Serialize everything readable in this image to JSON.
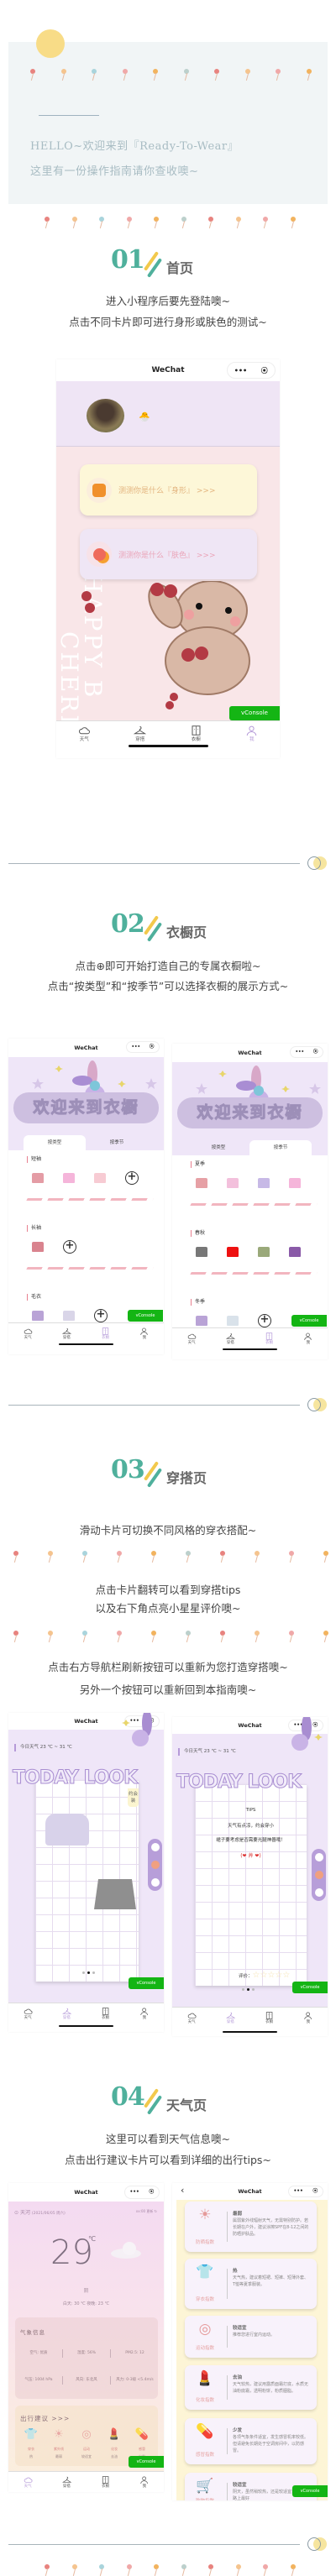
{
  "intro": {
    "greeting": "HELLO~欢迎来到『Ready-To-Wear』",
    "subtitle": "这里有一份操作指南请你查收噢~"
  },
  "colors": {
    "accent_teal": "#4fb09c",
    "accent_yellow": "#f2c94c",
    "lavender": "#efe5f5",
    "vconsole_green": "#14b514",
    "tab_active": "#b59ad8"
  },
  "lollipop_colors": [
    "#e8837f",
    "#f5c48e",
    "#a9d4dc",
    "#f0a8a8",
    "#f2b35e",
    "#bcd0cc",
    "#e8837f",
    "#f5c48e",
    "#f0a8a8",
    "#f2b35e"
  ],
  "sections": [
    {
      "num": "01",
      "title": "首页",
      "lines": [
        "进入小程序后要先登陆噢~",
        "点击不同卡片即可进行身形或肤色的测试~"
      ]
    },
    {
      "num": "02",
      "title": "衣橱页",
      "lines": [
        "点击⊕即可开始打造自己的专属衣橱啦~",
        "点击“按类型”和“按季节”可以选择衣橱的展示方式~"
      ]
    },
    {
      "num": "03",
      "title": "穿搭页",
      "lines": [
        "滑动卡片可切换不同风格的穿衣搭配~",
        "点击卡片翻转可以看到穿搭tips",
        "以及右下角点亮小星星评价噢~",
        "点击右方导航栏刷新按钮可以重新为您打造穿搭噢~",
        "另外一个按钮可以重新回到本指南噢~"
      ]
    },
    {
      "num": "04",
      "title": "天气页",
      "lines": [
        "这里可以看到天气信息噢~",
        "点击出行建议卡片可以看到详细的出行tips~"
      ]
    }
  ],
  "app": {
    "nav_title": "WeChat",
    "capsule_more": "•••",
    "capsule_close": "⦿",
    "back": "‹",
    "vconsole": "vConsole",
    "tabs": [
      {
        "label": "天气",
        "icon": "cloud-icon"
      },
      {
        "label": "穿搭",
        "icon": "hanger-icon"
      },
      {
        "label": "衣橱",
        "icon": "wardrobe-icon"
      },
      {
        "label": "我",
        "icon": "user-icon"
      }
    ]
  },
  "home": {
    "body_test": "测测你是什么『身形』 >>>",
    "skin_test": "测测你是什么『肤色』 >>>",
    "bg_text_1": "HAPPY B",
    "bg_text_2": "CHERR"
  },
  "wardrobe": {
    "banner": "欢迎来到衣橱",
    "tabs": [
      "按类型",
      "按季节"
    ],
    "by_type": [
      "短袖",
      "长袖",
      "毛衣"
    ],
    "by_season": [
      "夏季",
      "春秋",
      "冬季"
    ],
    "add": "+"
  },
  "outfit": {
    "weather": "今日天气 23 ℃ ~ 31 ℃",
    "banner": "TODAY LOOK",
    "tag": "约会装",
    "tips_title": "TIPS",
    "tips_1": "天气有点凉，约会穿小",
    "tips_2": "裙子要考虑是否需要光腿神器哦！",
    "kaomoji": "(❤ 艸 ❤)",
    "rating_label": "评价：",
    "rating": 0,
    "rating_max": 5,
    "current_slide": 2,
    "slides": 3
  },
  "weather": {
    "location": "天河",
    "date": "(2021/06/05 周六)",
    "update": "xx:00 更新",
    "temp": "29",
    "unit": "℃",
    "condition": "阴",
    "day_night": "白天: 30 ℃  夜晚: 23 ℃",
    "info_title": "气象信息",
    "info": [
      [
        "空气: 优质",
        "湿度: 56%",
        "PM2.5: 12"
      ],
      [
        "气压: 1004 hPa",
        "风向: 东北风",
        "风力: 0-3级 <5.4m/s"
      ]
    ],
    "advice_title": "出行建议 >>>",
    "advice_icons": [
      {
        "label": "穿衣",
        "value": "热"
      },
      {
        "label": "紫外线",
        "value": "最弱"
      },
      {
        "label": "运动",
        "value": "较适宜"
      },
      {
        "label": "化妆",
        "value": "去油"
      },
      {
        "label": "感冒",
        "value": "少发"
      }
    ]
  },
  "advice": [
    {
      "label": "防晒指数",
      "title": "最弱",
      "desc": "属弱紫外线辐射天气，无需特别防护。若长期在户外，建议涂擦SPF在8-12之间的防晒护肤品。",
      "icon": "sun-icon"
    },
    {
      "label": "穿衣指数",
      "title": "热",
      "desc": "天气热，建议着短裙、短裤、短薄外套、T恤等夏季服装。",
      "icon": "shirt-icon"
    },
    {
      "label": "运动指数",
      "title": "较适宜",
      "desc": "推荐您进行室内运动。",
      "icon": "ball-icon"
    },
    {
      "label": "化妆指数",
      "title": "去油",
      "desc": "天气较热，建议用露质面霜打底，水质无油粉底霜，透明粉饼，粉质胭脂。",
      "icon": "makeup-icon"
    },
    {
      "label": "感冒指数",
      "title": "少发",
      "desc": "各项气象条件适宜，发生感冒机率较低。但请避免长期处于空调房间中，以防感冒。",
      "icon": "pill-icon"
    },
    {
      "label": "购物指数",
      "title": "较适宜",
      "desc": "阴天，虽然稍较热，还是较适宜逛街的，路上最好",
      "icon": "cart-icon"
    }
  ]
}
